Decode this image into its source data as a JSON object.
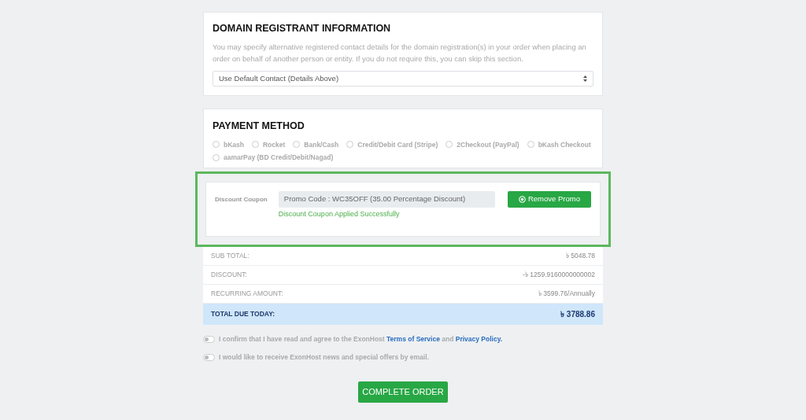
{
  "registrant": {
    "title": "DOMAIN REGISTRANT INFORMATION",
    "description": "You may specify alternative registered contact details for the domain registration(s) in your order when placing an order on behalf of another person or entity. If you do not require this, you can skip this section.",
    "select_value": "Use Default Contact (Details Above)"
  },
  "payment": {
    "title": "PAYMENT METHOD",
    "options": [
      {
        "label": "bKash",
        "selected": false
      },
      {
        "label": "Rocket",
        "selected": false
      },
      {
        "label": "Bank/Cash",
        "selected": false
      },
      {
        "label": "Credit/Debit Card (Stripe)",
        "selected": false
      },
      {
        "label": "2Checkout (PayPal)",
        "selected": false
      },
      {
        "label": "bKash Checkout",
        "selected": false
      },
      {
        "label": "aamarPay (BD Credit/Debit/Nagad)",
        "selected": false
      }
    ]
  },
  "coupon": {
    "label": "Discount Coupon",
    "value": "Promo Code : WC35OFF (35.00 Percentage Discount)",
    "message": "Discount Coupon Applied Successfully",
    "button": "Remove Promo",
    "highlighted": true
  },
  "totals": [
    {
      "label": "SUB TOTAL:",
      "value": "৳ 5048.78",
      "kind": "row"
    },
    {
      "label": "DISCOUNT:",
      "value": "-৳ 1259.9160000000002",
      "kind": "row"
    },
    {
      "label": "RECURRING AMOUNT:",
      "value": "৳ 3599.76/Annually",
      "kind": "row"
    },
    {
      "label": "TOTAL DUE TODAY:",
      "value": "৳ 3788.86",
      "kind": "total"
    }
  ],
  "agreements": [
    {
      "parts": [
        {
          "text": "I confirm that I have read and agree to the ExonHost ",
          "link": false
        },
        {
          "text": "Terms of Service",
          "link": true
        },
        {
          "text": " and ",
          "link": false
        },
        {
          "text": "Privacy Policy.",
          "link": true
        }
      ],
      "on": false
    },
    {
      "parts": [
        {
          "text": "I would like to receive ExonHost news and special offers by email.",
          "link": false
        }
      ],
      "on": false
    }
  ],
  "submit": "COMPLETE ORDER"
}
